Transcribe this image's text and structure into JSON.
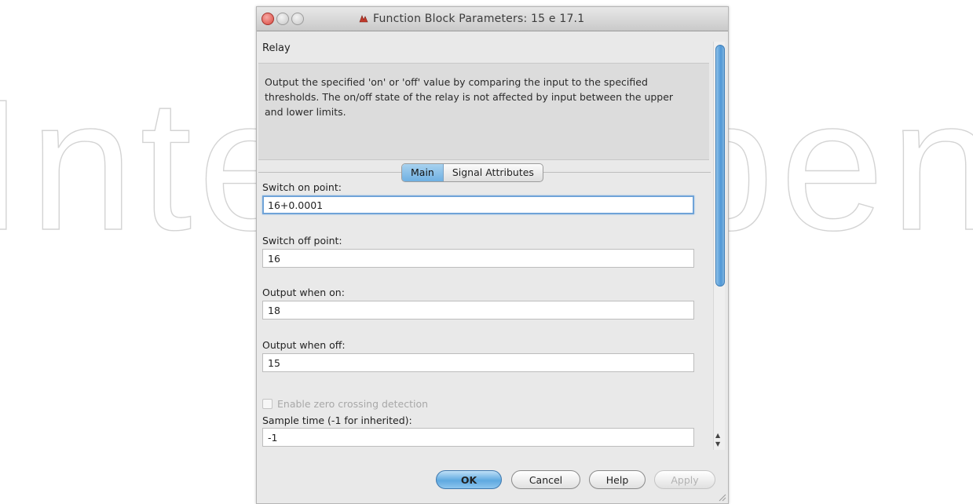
{
  "watermark": {
    "text": "IntechOpen"
  },
  "window": {
    "title": "Function Block Parameters: 15 e 17.1",
    "block_name": "Relay",
    "description": "Output the specified 'on' or 'off' value by comparing the input to the specified thresholds.  The on/off state of the relay is not affected by input between the upper and lower limits."
  },
  "tabs": [
    {
      "label": "Main",
      "active": true
    },
    {
      "label": "Signal Attributes",
      "active": false
    }
  ],
  "fields": {
    "switch_on": {
      "label": "Switch on point:",
      "value": "16+0.0001"
    },
    "switch_off": {
      "label": "Switch off point:",
      "value": "16"
    },
    "output_on": {
      "label": "Output when on:",
      "value": "18"
    },
    "output_off": {
      "label": "Output when off:",
      "value": "15"
    },
    "sample_time": {
      "label": "Sample time (-1 for inherited):",
      "value": "-1"
    }
  },
  "checkbox": {
    "label": "Enable zero crossing detection",
    "checked": false,
    "enabled": false
  },
  "buttons": {
    "ok": "OK",
    "cancel": "Cancel",
    "help": "Help",
    "apply": "Apply"
  },
  "colors": {
    "accent": "#5ea9e0",
    "close_button": "#d9473e"
  }
}
